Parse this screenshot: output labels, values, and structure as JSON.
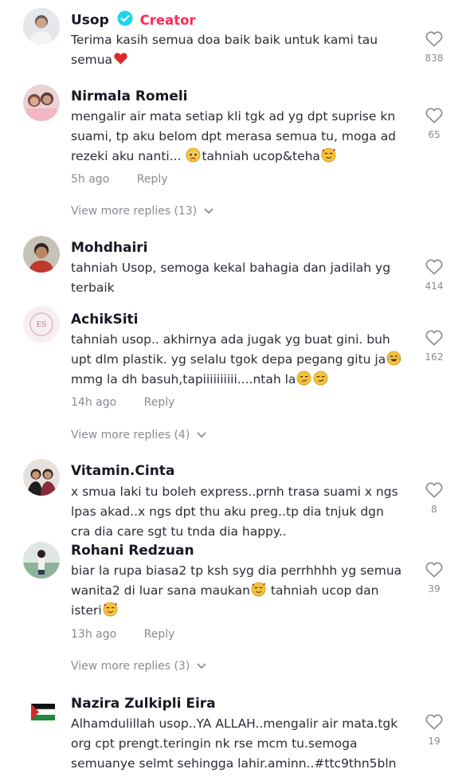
{
  "comments": [
    {
      "username": "Usop",
      "creator_badge": "Creator",
      "text": "Terima kasih semua doa baik baik untuk kami tau semua",
      "likes": "838"
    },
    {
      "username": "Nirmala Romeli",
      "text_line1": "mengalir air mata setiap kli tgk ad yg dpt suprise kn",
      "text_line2": "suami, tp aku belom dpt merasa semua tu, moga ad",
      "text_line3_a": "rezeki aku nanti...",
      "text_line3_b": "tahniah ucop&teha",
      "time": "5h ago",
      "reply": "Reply",
      "view_more": "View more replies (13)",
      "likes": "65"
    },
    {
      "username": "Mohdhairi",
      "text": "tahniah Usop, semoga kekal bahagia dan jadilah yg terbaik",
      "likes": "414"
    },
    {
      "username": "AchikSiti",
      "text_line1": "tahniah usop.. akhirnya ada jugak yg buat gini. buh",
      "text_line2": "upt dlm plastik. yg selalu tgok depa pegang gitu ja",
      "text_line3": "mmg la dh basuh,tapiiiiiiiiii....ntah la",
      "time": "14h ago",
      "reply": "Reply",
      "view_more": "View more replies (4)",
      "likes": "162"
    },
    {
      "username": "Vitamin.Cinta",
      "text": "x smua laki tu boleh express..prnh trasa suami x ngs lpas akad..x ngs dpt thu aku preg..tp dia tnjuk dgn cra dia care sgt tu tnda dia happy..",
      "likes": "8"
    },
    {
      "username": "Rohani Redzuan",
      "text_line1": "biar la rupa biasa2 tp ksh syg dia perrhhhh yg semua",
      "text_line2": "wanita2 di luar sana maukan",
      "text_line2_b": "tahniah ucop dan",
      "text_line3": "isteri",
      "time": "13h ago",
      "reply": "Reply",
      "view_more": "View more replies (3)",
      "likes": "39"
    },
    {
      "username": "Nazira Zulkipli Eira",
      "text": "Alhamdulillah usop..YA ALLAH..mengalir air mata.tgk org cpt prengt.teringin nk rse mcm tu.semoga semuanye selmt sehingga lahir.aminn..#ttc9thn5bln",
      "likes": "19"
    }
  ],
  "colors": {
    "accent": "#fe2c55",
    "verified": "#20d5ec",
    "muted": "#8a8b91"
  },
  "icons": {
    "like": "heart-outline-icon",
    "verified": "verified-badge-icon",
    "expand": "chevron-down-icon"
  }
}
